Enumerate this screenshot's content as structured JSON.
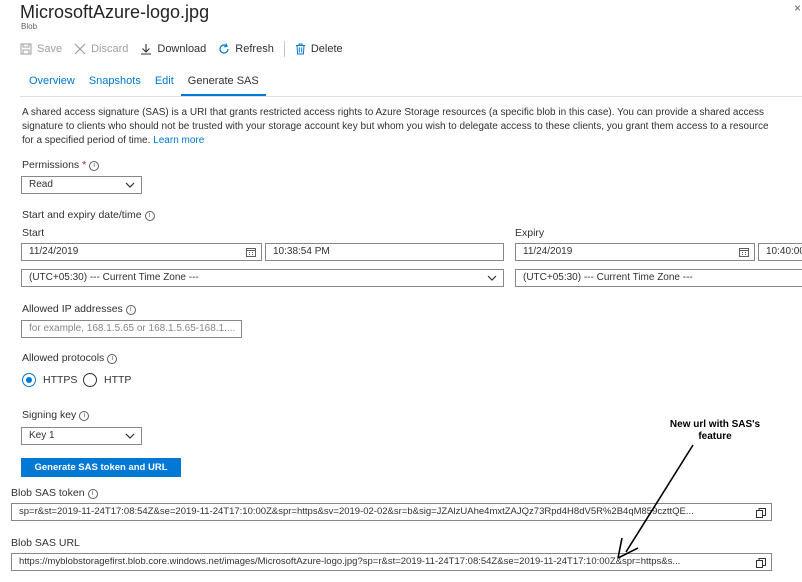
{
  "header": {
    "title": "MicrosoftAzure-logo.jpg",
    "subtitle": "Blob",
    "close_glyph": "×"
  },
  "toolbar": {
    "save": "Save",
    "discard": "Discard",
    "download": "Download",
    "refresh": "Refresh",
    "delete": "Delete"
  },
  "tabs": [
    "Overview",
    "Snapshots",
    "Edit",
    "Generate SAS"
  ],
  "active_tab": "Generate SAS",
  "description": "A shared access signature (SAS) is a URI that grants restricted access rights to Azure Storage resources (a specific blob in this case). You can provide a shared access signature to clients who should not be trusted with your storage account key but whom you wish to delegate access to these clients, you grant them access to a resource for a specified period of time.",
  "learn_more": "Learn more",
  "permissions": {
    "label": "Permissions",
    "required_mark": "*",
    "value": "Read"
  },
  "dates": {
    "label": "Start and expiry date/time",
    "start_label": "Start",
    "start_date": "11/24/2019",
    "start_time": "10:38:54 PM",
    "start_tz": "(UTC+05:30) --- Current Time Zone ---",
    "expiry_label": "Expiry",
    "expiry_date": "11/24/2019",
    "expiry_time": "10:40:00",
    "expiry_tz": "(UTC+05:30) --- Current Time Zone ---"
  },
  "ip": {
    "label": "Allowed IP addresses",
    "placeholder": "for example, 168.1.5.65 or 168.1.5.65-168.1...."
  },
  "protocols": {
    "label": "Allowed protocols",
    "https": "HTTPS",
    "http": "HTTP",
    "selected": "HTTPS"
  },
  "signing": {
    "label": "Signing key",
    "value": "Key 1"
  },
  "generate_button": "Generate SAS token and URL",
  "sas_token": {
    "label": "Blob SAS token",
    "value": "sp=r&st=2019-11-24T17:08:54Z&se=2019-11-24T17:10:00Z&spr=https&sv=2019-02-02&sr=b&sig=JZAlzUAhe4mxtZAJQz73Rpd4H8dV5R%2B4qM859czttQE..."
  },
  "sas_url": {
    "label": "Blob SAS URL",
    "value": "https://myblobstoragefirst.blob.core.windows.net/images/MicrosoftAzure-logo.jpg?sp=r&st=2019-11-24T17:08:54Z&se=2019-11-24T17:10:00Z&spr=https&s..."
  },
  "annotation": {
    "line1": "New url with SAS's",
    "line2": "feature"
  },
  "colors": {
    "accent": "#0078d4",
    "text": "#323130",
    "border": "#8a8886",
    "required": "#a4262c"
  },
  "icons": {
    "save": "save-icon",
    "discard": "discard-icon",
    "download": "download-icon",
    "refresh": "refresh-icon",
    "delete": "delete-icon",
    "calendar": "calendar-icon",
    "chevron": "chevron-down-icon",
    "copy": "copy-icon",
    "info": "info-icon"
  }
}
